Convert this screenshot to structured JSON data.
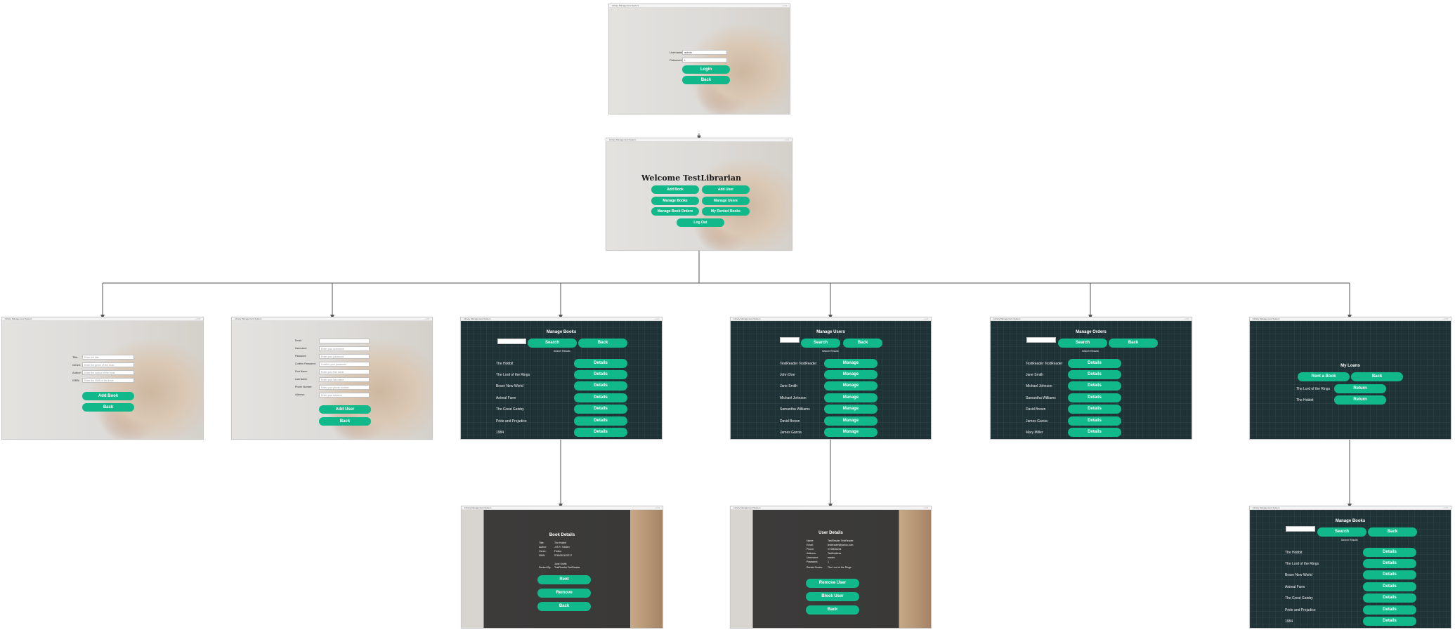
{
  "login": {
    "window_title": "Library Management System",
    "username_label": "Username:",
    "username_value": "admin",
    "password_label": "Password:",
    "password_value": "•",
    "login_label": "Login",
    "back_label": "Back"
  },
  "dashboard": {
    "window_title": "Library Management System",
    "welcome": "Welcome TestLibrarian",
    "add_book": "Add Book",
    "add_user": "Add User",
    "manage_books": "Manage Books",
    "manage_users": "Manage Users",
    "manage_book_orders": "Manage Book Orders",
    "my_rented_books": "My Rented Books",
    "log_out": "Log Out"
  },
  "add_book": {
    "window_title": "Library Management System",
    "fields": [
      {
        "label": "Title:",
        "placeholder": "Enter the title"
      },
      {
        "label": "Genre:",
        "placeholder": "Enter the genre of the book"
      },
      {
        "label": "Author:",
        "placeholder": "Enter the author of the book"
      },
      {
        "label": "ISBN:",
        "placeholder": "Enter the ISBN of the book"
      }
    ],
    "add_label": "Add Book",
    "back_label": "Back"
  },
  "add_user": {
    "window_title": "Library Management System",
    "fields": [
      {
        "label": "Email:",
        "placeholder": ""
      },
      {
        "label": "Username:",
        "placeholder": "Enter your username"
      },
      {
        "label": "Password:",
        "placeholder": "Enter your password"
      },
      {
        "label": "Confirm Password:",
        "placeholder": "Confirm your password"
      },
      {
        "label": "First Name:",
        "placeholder": "Enter your first name"
      },
      {
        "label": "Last Name:",
        "placeholder": "Enter your last name"
      },
      {
        "label": "Phone Number:",
        "placeholder": "Enter your phone number"
      },
      {
        "label": "Address:",
        "placeholder": "Enter your address"
      }
    ],
    "add_label": "Add User",
    "back_label": "Back"
  },
  "manage_books": {
    "window_title": "Library Management System",
    "title": "Manage Books",
    "search_label": "Search",
    "back_label": "Back",
    "results_label": "Search Results",
    "action_label": "Details",
    "rows": [
      "The Hobbit",
      "The Lord of the Rings",
      "Brave New World",
      "Animal Farm",
      "The Great Gatsby",
      "Pride and Prejudice",
      "1984"
    ]
  },
  "manage_users": {
    "window_title": "Library Management System",
    "title": "Manage Users",
    "search_label": "Search",
    "back_label": "Back",
    "results_label": "Search Results",
    "action_label": "Manage",
    "rows": [
      "TestReader TestReader",
      "John Doe",
      "Jane Smith",
      "Michael Johnson",
      "Samantha Williams",
      "David Brown",
      "James Garcia"
    ]
  },
  "manage_orders": {
    "window_title": "Library Management System",
    "title": "Manage Orders",
    "search_label": "Search",
    "back_label": "Back",
    "results_label": "Search Results",
    "action_label": "Details",
    "rows": [
      "TestReader TestReader",
      "Jane Smith",
      "Michael Johnson",
      "Samantha Williams",
      "David Brown",
      "James Garcia",
      "Mary Miller"
    ]
  },
  "my_loans": {
    "window_title": "Library Management System",
    "title": "My Loans",
    "rent_label": "Rent a Book",
    "back_label": "Back",
    "return_label": "Return",
    "rows": [
      "The Lord of the Rings",
      "The Hobbit"
    ]
  },
  "book_details": {
    "window_title": "Library Management System",
    "title": "Book Details",
    "rows": [
      {
        "k": "Title:",
        "v": "The Hobbit"
      },
      {
        "k": "Author:",
        "v": "J.R.R. Tolkien"
      },
      {
        "k": "Genre:",
        "v": "Fiction"
      },
      {
        "k": "ISBN:",
        "v": "9780261102217"
      },
      {
        "k": "",
        "v": "Jane Smith"
      },
      {
        "k": "Rented By:",
        "v": "TestReader TestReader"
      }
    ],
    "rent_label": "Rent",
    "remove_label": "Remove",
    "back_label": "Back"
  },
  "user_details": {
    "window_title": "Library Management System",
    "title": "User Details",
    "rows": [
      {
        "k": "Name:",
        "v": "TestReader TestReader"
      },
      {
        "k": "Email:",
        "v": "testreader@yahoo.com"
      },
      {
        "k": "Phone:",
        "v": "0745634234"
      },
      {
        "k": "Address:",
        "v": "TestAddress"
      },
      {
        "k": "Username:",
        "v": "reader"
      },
      {
        "k": "Password:",
        "v": "1"
      },
      {
        "k": "Rented Books:",
        "v": "The Lord of the Rings"
      }
    ],
    "remove_label": "Remove User",
    "block_label": "Block User",
    "back_label": "Back"
  },
  "rent_books": {
    "window_title": "Library Management System",
    "title": "Manage Books",
    "search_label": "Search",
    "back_label": "Back",
    "results_label": "Search Results",
    "action_label": "Details",
    "rows": [
      "The Hobbit",
      "The Lord of the Rings",
      "Brave New World",
      "Animal Farm",
      "The Great Gatsby",
      "Pride and Prejudice",
      "1984"
    ]
  },
  "colors": {
    "accent": "#11b98a",
    "teal_bg": "#1f3337",
    "connector": "#555555"
  }
}
